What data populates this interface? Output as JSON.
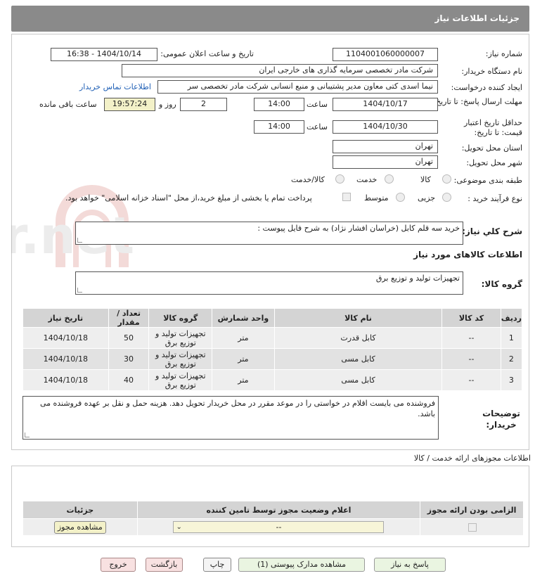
{
  "header": {
    "title": "جزئیات اطلاعات نیاز"
  },
  "form": {
    "need_number_label": "شماره نیاز:",
    "need_number": "1104001060000007",
    "announce_label": "تاریخ و ساعت اعلان عمومی:",
    "announce_value": "1404/10/14 - 16:38",
    "buyer_org_label": "نام دستگاه خریدار:",
    "buyer_org": "شرکت مادر تخصصی سرمایه گذاری های خارجی ایران",
    "creator_label": "ایجاد کننده درخواست:",
    "creator": "نیما اسدی کتی  معاون مدیر پشتیبانی و منبع انسانی شرکت مادر تخصصی سر",
    "contact_link": "اطلاعات تماس خریدار",
    "deadline_label": "مهلت ارسال پاسخ: تا تاریخ:",
    "deadline_date": "1404/10/17",
    "time_label": "ساعت",
    "deadline_time": "14:00",
    "days_value": "2",
    "days_label": "روز و",
    "remaining_time": "19:57:24",
    "remaining_label": "ساعت باقی مانده",
    "validity_label": "حداقل تاریخ اعتبار قیمت: تا تاریخ:",
    "validity_date": "1404/10/30",
    "validity_time": "14:00",
    "province_label": "استان محل تحویل:",
    "province": "تهران",
    "city_label": "شهر محل تحویل:",
    "city": "تهران",
    "category_label": "طبقه بندی موضوعی:",
    "category_options": [
      "کالا",
      "خدمت",
      "کالا/خدمت"
    ],
    "process_label": "نوع فرآیند خرید :",
    "process_options": [
      "جزیی",
      "متوسط"
    ],
    "payment_note": "پرداخت تمام یا بخشی از مبلغ خرید،از محل \"اسناد خزانه اسلامی\" خواهد بود.",
    "description_label": "شرح کلي نياز:",
    "description": "خرید سه قلم کابل (خراسان افشار نژاد) به شرح فایل پیوست :",
    "goods_info_title": "اطلاعات کالاهای مورد نیاز",
    "goods_group_label": "گروه کالا:",
    "goods_group": "تجهیزات تولید و توزیع برق"
  },
  "items_table": {
    "headers": [
      "ردیف",
      "کد کالا",
      "نام کالا",
      "واحد شمارش",
      "گروه کالا",
      "تعداد / مقدار",
      "تاریخ نیاز"
    ],
    "rows": [
      {
        "row": "1",
        "code": "--",
        "name": "کابل قدرت",
        "unit": "متر",
        "group": "تجهیزات تولید و توزیع برق",
        "qty": "50",
        "date": "1404/10/18"
      },
      {
        "row": "2",
        "code": "--",
        "name": "کابل مسی",
        "unit": "متر",
        "group": "تجهیزات تولید و توزیع برق",
        "qty": "30",
        "date": "1404/10/18"
      },
      {
        "row": "3",
        "code": "--",
        "name": "کابل مسی",
        "unit": "متر",
        "group": "تجهیزات تولید و توزیع برق",
        "qty": "40",
        "date": "1404/10/18"
      }
    ]
  },
  "buyer_notes": {
    "label": "توضیحات خریدار:",
    "text": "فروشنده می بایست اقلام در خواستی را در موعد مقرر در محل خریدار تحویل دهد. هزینه حمل و نقل  بر عهده فروشنده می باشد."
  },
  "licenses": {
    "title": "اطلاعات مجوزهای ارائه خدمت / کالا",
    "headers": [
      "الزامی بودن ارائه مجوز",
      "اعلام وضعیت مجوز توسط تامین کننده",
      "جزئیات"
    ],
    "status_value": "--",
    "view_button": "مشاهده مجوز"
  },
  "buttons": {
    "reply": "پاسخ به نیاز",
    "attachments": "مشاهده مدارک پیوستی (1)",
    "print": "چاپ",
    "back": "بازگشت",
    "exit": "خروج"
  },
  "watermark": {
    "text": "AriaTender.net"
  }
}
